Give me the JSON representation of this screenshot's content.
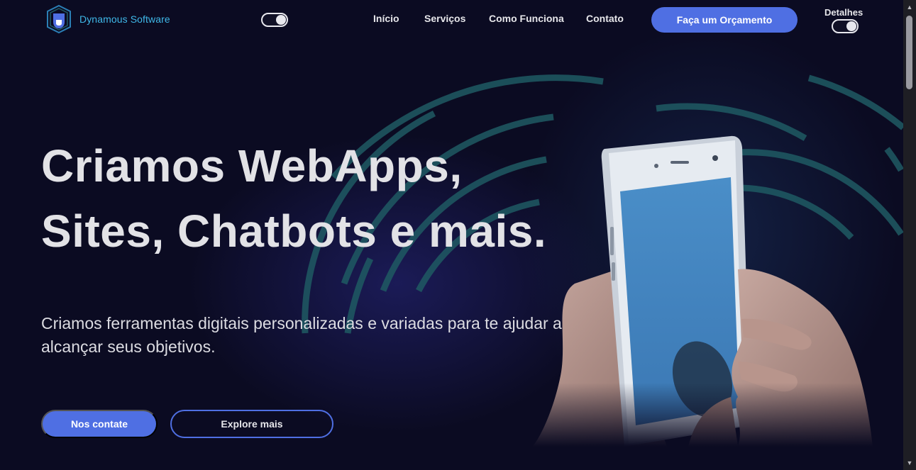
{
  "header": {
    "brand_name": "Dynamous Software",
    "nav": [
      "Início",
      "Serviços",
      "Como Funciona",
      "Contato"
    ],
    "cta_label": "Faça um Orçamento",
    "details_label": "Detalhes",
    "theme_toggle_on": true,
    "details_toggle_on": true
  },
  "hero": {
    "title_line1": "Criamos WebApps,",
    "title_line2": "Sites, Chatbots e mais.",
    "subtitle": "Criamos ferramentas digitais personalizadas e variadas para te ajudar a alcançar seus objetivos.",
    "primary_button": "Nos contate",
    "secondary_button": "Explore mais",
    "illustration": "hand-holding-smartphone"
  },
  "colors": {
    "background": "#0b0b22",
    "accent": "#4f6fe3",
    "brand_text": "#3fb8e8",
    "arc": "#1f5a63",
    "text": "#e2e2e6"
  },
  "icons": {
    "logo": "dynamous-logo-icon",
    "scroll_up": "chevron-up-icon",
    "scroll_down": "chevron-down-icon"
  }
}
